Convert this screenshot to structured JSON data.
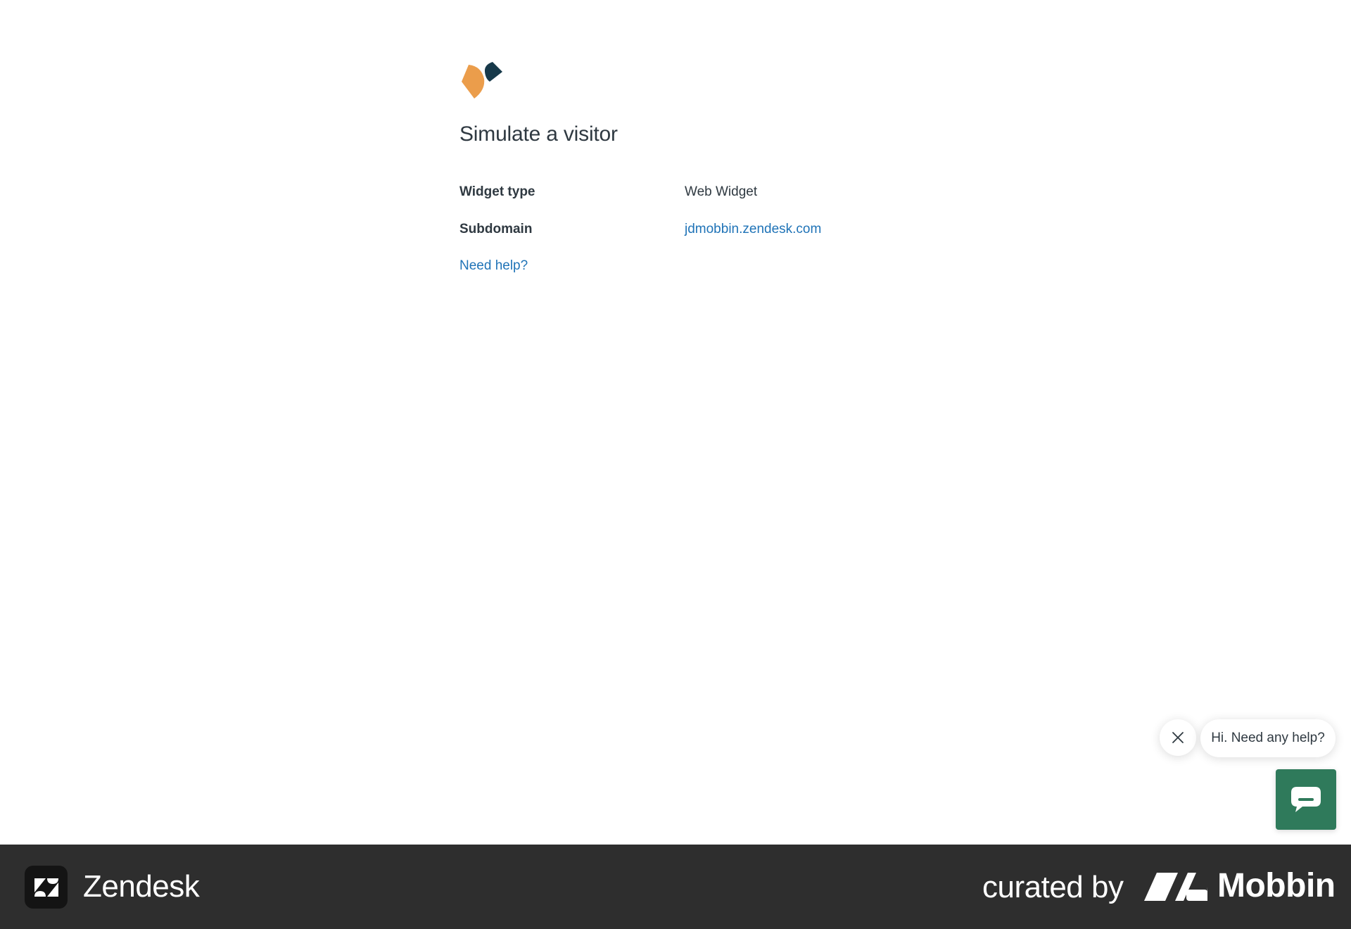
{
  "page": {
    "title": "Simulate a visitor",
    "rows": [
      {
        "label": "Widget type",
        "value": "Web Widget"
      },
      {
        "label": "Subdomain",
        "value": "jdmobbin.zendesk.com"
      }
    ],
    "help_link": "Need help?"
  },
  "widget": {
    "greeting": "Hi. Need any help?",
    "close_icon": "close-icon",
    "launcher_icon": "chat-bubble-icon",
    "launcher_color": "#2f7a5b"
  },
  "footer": {
    "brand": "Zendesk",
    "curated_by": "curated by",
    "curator": "Mobbin"
  },
  "colors": {
    "link": "#1f73b7",
    "text": "#2f3941",
    "logo_orange": "#eb9d4b",
    "logo_dark": "#17394a",
    "footer_bg": "#2e2e2e"
  }
}
